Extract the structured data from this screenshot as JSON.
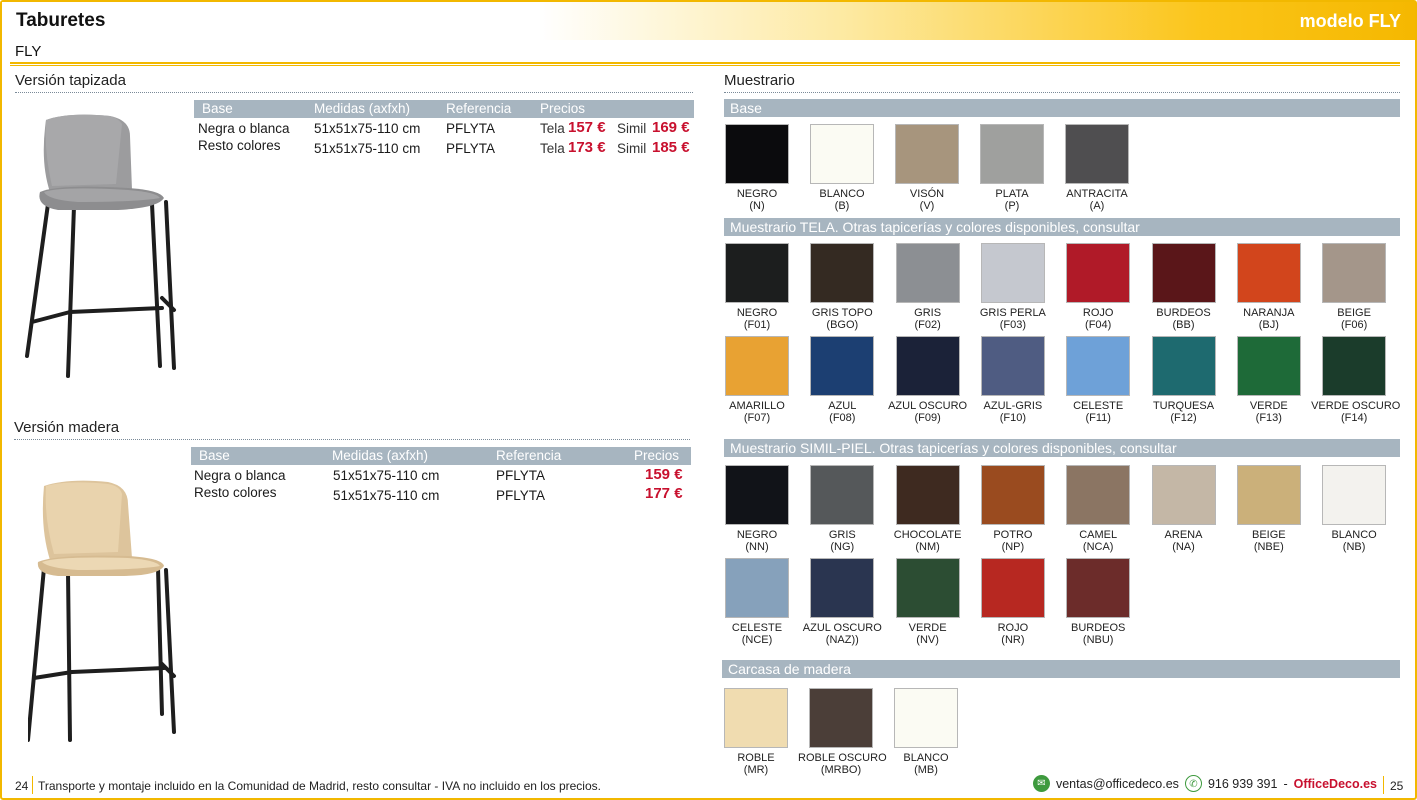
{
  "header": {
    "title": "Taburetes",
    "model": "modelo FLY"
  },
  "subtitle": "FLY",
  "tapizada": {
    "title": "Versión tapizada",
    "headers": [
      "Base",
      "Medidas (axfxh)",
      "Referencia",
      "Precios"
    ],
    "rows": [
      {
        "base": "Negra o blanca",
        "medidas": "51x51x75-110 cm",
        "ref": "PFLYTA",
        "tela_label": "Tela",
        "tela_price": "157 €",
        "simil_label": "Simil",
        "simil_price": "169 €"
      },
      {
        "base": "Resto colores",
        "medidas": "51x51x75-110 cm",
        "ref": "PFLYTA",
        "tela_label": "Tela",
        "tela_price": "173 €",
        "simil_label": "Simil",
        "simil_price": "185 €"
      }
    ]
  },
  "madera": {
    "title": "Versión madera",
    "headers": [
      "Base",
      "Medidas (axfxh)",
      "Referencia",
      "Precios"
    ],
    "rows": [
      {
        "base": "Negra o blanca",
        "medidas": "51x51x75-110 cm",
        "ref": "PFLYTA",
        "price": "159 €"
      },
      {
        "base": "Resto colores",
        "medidas": "51x51x75-110 cm",
        "ref": "PFLYTA",
        "price": "177 €"
      }
    ]
  },
  "muestrario": {
    "title": "Muestrario",
    "base_title": "Base",
    "base": [
      {
        "name": "NEGRO",
        "code": "(N)",
        "color": "#0b0b0d"
      },
      {
        "name": "BLANCO",
        "code": "(B)",
        "color": "#fbfbf3"
      },
      {
        "name": "VISÓN",
        "code": "(V)",
        "color": "#a7957d"
      },
      {
        "name": "PLATA",
        "code": "(P)",
        "color": "#9fa09e"
      },
      {
        "name": "ANTRACITA",
        "code": "(A)",
        "color": "#4f4e50"
      }
    ],
    "tela_title": "Muestrario TELA. Otras tapicerías y colores disponibles, consultar",
    "tela": [
      {
        "name": "NEGRO",
        "code": "(F01)",
        "color": "#1c1e1e"
      },
      {
        "name": "GRIS TOPO",
        "code": "(BGO)",
        "color": "#342a22"
      },
      {
        "name": "GRIS",
        "code": "(F02)",
        "color": "#8c8f93"
      },
      {
        "name": "GRIS PERLA",
        "code": "(F03)",
        "color": "#c5c8cf"
      },
      {
        "name": "ROJO",
        "code": "(F04)",
        "color": "#b01a28"
      },
      {
        "name": "BURDEOS",
        "code": "(BB)",
        "color": "#5a1619"
      },
      {
        "name": "NARANJA",
        "code": "(BJ)",
        "color": "#d2451c"
      },
      {
        "name": "BEIGE",
        "code": "(F06)",
        "color": "#a4968a"
      },
      {
        "name": "AMARILLO",
        "code": "(F07)",
        "color": "#e8a233"
      },
      {
        "name": "AZUL",
        "code": "(F08)",
        "color": "#1c3f72"
      },
      {
        "name": "AZUL OSCURO",
        "code": "(F09)",
        "color": "#1b2238"
      },
      {
        "name": "AZUL-GRIS",
        "code": "(F10)",
        "color": "#4f5c82"
      },
      {
        "name": "CELESTE",
        "code": "(F11)",
        "color": "#6ea1d8"
      },
      {
        "name": "TURQUESA",
        "code": "(F12)",
        "color": "#1e6a6f"
      },
      {
        "name": "VERDE",
        "code": "(F13)",
        "color": "#1e6a38"
      },
      {
        "name": "VERDE OSCURO",
        "code": "(F14)",
        "color": "#1b3c2b"
      }
    ],
    "simil_title": "Muestrario SIMIL-PIEL. Otras tapicerías y colores disponibles, consultar",
    "simil": [
      {
        "name": "NEGRO",
        "code": "(NN)",
        "color": "#111318"
      },
      {
        "name": "GRIS",
        "code": "(NG)",
        "color": "#55585a"
      },
      {
        "name": "CHOCOLATE",
        "code": "(NM)",
        "color": "#3e2a20"
      },
      {
        "name": "POTRO",
        "code": "(NP)",
        "color": "#9a4b1f"
      },
      {
        "name": "CAMEL",
        "code": "(NCA)",
        "color": "#8b7563"
      },
      {
        "name": "ARENA",
        "code": "(NA)",
        "color": "#c4b7a6"
      },
      {
        "name": "BEIGE",
        "code": "(NBE)",
        "color": "#cbb07a"
      },
      {
        "name": "BLANCO",
        "code": "(NB)",
        "color": "#f3f2ee"
      },
      {
        "name": "CELESTE",
        "code": "(NCE)",
        "color": "#86a1bb"
      },
      {
        "name": "AZUL OSCURO",
        "code": "(NAZ))",
        "color": "#2a3550"
      },
      {
        "name": "VERDE",
        "code": "(NV)",
        "color": "#2c4d33"
      },
      {
        "name": "ROJO",
        "code": "(NR)",
        "color": "#b72821"
      },
      {
        "name": "BURDEOS",
        "code": "(NBU)",
        "color": "#6c2c2a"
      }
    ],
    "carcasa_title": "Carcasa de madera",
    "carcasa": [
      {
        "name": "ROBLE",
        "code": "(MR)",
        "color": "#f0dcb0"
      },
      {
        "name": "ROBLE OSCURO",
        "code": "(MRBO)",
        "color": "#4b3e38"
      },
      {
        "name": "BLANCO",
        "code": "(MB)",
        "color": "#fbfbf3"
      }
    ]
  },
  "footer": {
    "page_left": "24",
    "note": "Transporte y montaje incluido en la Comunidad de Madrid, resto consultar - IVA no incluido en los precios.",
    "email": "ventas@officedeco.es",
    "phone": "916 939 391",
    "dash": "-",
    "brand": "OfficeDeco.es",
    "page_right": "25"
  }
}
